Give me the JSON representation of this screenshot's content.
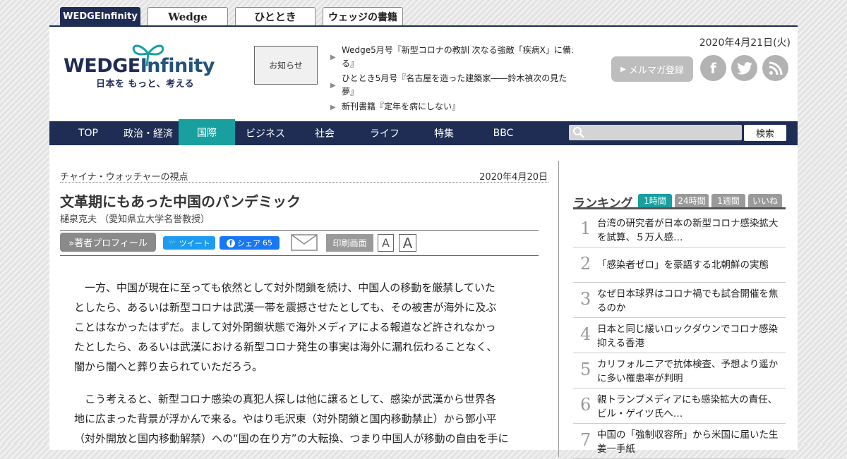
{
  "site_tabs": [
    {
      "label": "WEDGE",
      "label2": "Infinity"
    },
    {
      "label": "Wedge"
    },
    {
      "label": "ひととき"
    },
    {
      "label": "ウェッジの書籍"
    }
  ],
  "header": {
    "logo_text_a": "WEDGE",
    "logo_text_b": "Infinity",
    "logo_tagline": "日本を もっと、考える",
    "notice_label": "お知らせ",
    "news": [
      {
        "line1": "Wedge5月号『新型コロナの教訓 次なる強敵「疾病X」に備え",
        "line2": "る』"
      },
      {
        "line1": "ひととき5月号『名古屋を造った建築家――鈴木禎次の見た",
        "line2": "夢』"
      },
      {
        "line1": "新刊書籍『定年を病にしない』",
        "line2": ""
      }
    ],
    "date": "2020年4月21日(火)",
    "newsletter_label": "メルマガ登録",
    "social": [
      "facebook-icon",
      "twitter-icon",
      "rss-icon"
    ]
  },
  "nav": {
    "items": [
      "TOP",
      "政治・経済",
      "国際",
      "ビジネス",
      "社会",
      "ライフ",
      "特集",
      "BBC"
    ],
    "active": "国際",
    "search_label": "検索",
    "search_placeholder": ""
  },
  "article": {
    "series": "チャイナ・ウォッチャーの視点",
    "date": "2020年4月20日",
    "title": "文革期にもあった中国のパンデミック",
    "author": "樋泉克夫 （愛知県立大学名誉教授）",
    "profile_label": "»著者プロフィール",
    "tweet_label": "ツイート",
    "share_label": "シェア",
    "share_count": "65",
    "print_label": "印刷画面",
    "font_small": "A",
    "font_large": "A",
    "paragraphs": [
      [
        "　一方、中国が現在に至っても依然として対外閉鎖を続け、中国人の移動を厳禁していた",
        "としたら、あるいは新型コロナは武漢一帯を震撼させたとしても、その被害が海外に及ぶ",
        "ことはなかったはずだ。まして対外閉鎖状態で海外メディアによる報道など許されなかっ",
        "たとしたら、あるいは武漢における新型コロナ発生の事実は海外に漏れ伝わることなく、",
        "闇から闇へと葬り去られていただろう。"
      ],
      [
        "　こう考えると、新型コロナ感染の真犯人探しは他に譲るとして、感染が武漢から世界各",
        "地に広まった背景が浮かんで来る。やはり毛沢東（対外閉鎖と国内移動禁止）から鄧小平",
        "（対外開放と国内移動解禁）への“国の在り方”の大転換、つまり中国人が移動の自由を手に"
      ]
    ]
  },
  "ranking": {
    "title": "ランキング",
    "tabs": [
      "1時間",
      "24時間",
      "1週間",
      "いいね"
    ],
    "active_tab": "1時間",
    "items": [
      {
        "rank": "1",
        "text": "台湾の研究者が日本の新型コロナ感染拡大を試算、５万人感…"
      },
      {
        "rank": "2",
        "text": "「感染者ゼロ」を豪語する北朝鮮の実態"
      },
      {
        "rank": "3",
        "text": "なぜ日本球界はコロナ禍でも試合開催を焦るのか"
      },
      {
        "rank": "4",
        "text": "日本と同じ緩いロックダウンでコロナ感染抑える香港"
      },
      {
        "rank": "5",
        "text": "カリフォルニアで抗体検査、予想より遥かに多い罹患率が判明"
      },
      {
        "rank": "6",
        "text": "親トランプメディアにも感染拡大の責任、ビル・ゲイツ氏へ…"
      },
      {
        "rank": "7",
        "text": "中国の「強制収容所」から米国に届いた生姜一手紙"
      }
    ]
  }
}
